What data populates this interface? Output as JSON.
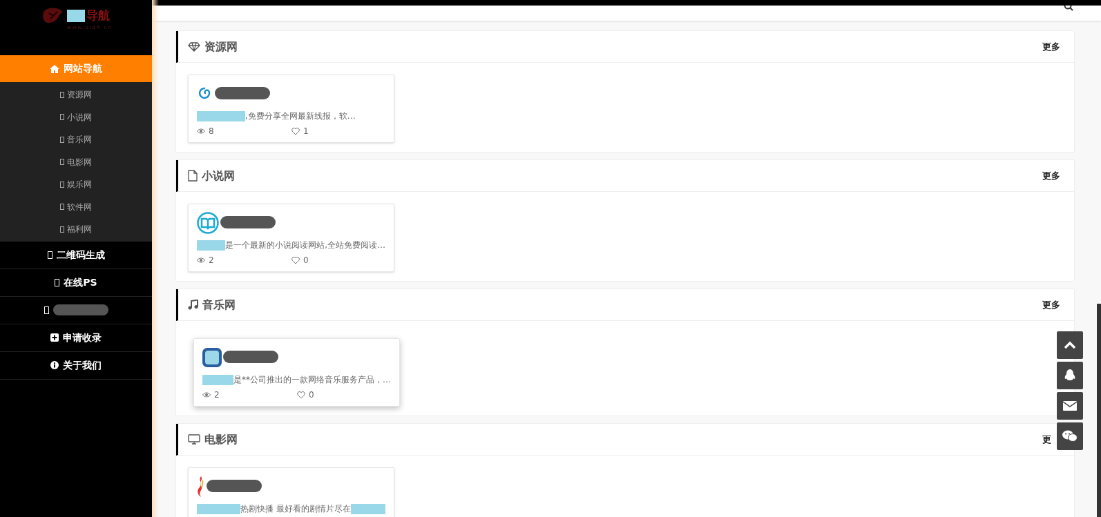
{
  "sidebar": {
    "logo": {
      "text": "导航",
      "subtitle": "www.sidh.cn"
    },
    "nav": [
      {
        "label": "网站导航",
        "kind": "home",
        "selected": true,
        "children": [
          {
            "label": "资源网"
          },
          {
            "label": "小说网"
          },
          {
            "label": "音乐网"
          },
          {
            "label": "电影网"
          },
          {
            "label": "娱乐网"
          },
          {
            "label": "软件网"
          },
          {
            "label": "福利网"
          }
        ]
      },
      {
        "label": "二维码生成",
        "kind": "box",
        "selected": false
      },
      {
        "label": "在线PS",
        "kind": "box",
        "selected": false
      },
      {
        "kind": "hidden",
        "selected": false
      },
      {
        "label": "申请收录",
        "kind": "plus",
        "selected": false
      },
      {
        "label": "关于我们",
        "kind": "info",
        "selected": false
      }
    ]
  },
  "sections": [
    {
      "title": "资源网",
      "kind": "diamond",
      "more": "更多",
      "cards": [
        {
          "description": ",免费分享全网最新线报，软…",
          "views": "8",
          "likes": "1",
          "hovered": false
        }
      ]
    },
    {
      "title": "小说网",
      "kind": "file",
      "more": "更多",
      "cards": [
        {
          "description": "是一个最新的小说阅读网站,全站免费阅读…",
          "views": "2",
          "likes": "0",
          "hovered": false
        }
      ]
    },
    {
      "title": "音乐网",
      "kind": "music",
      "more": "更多",
      "cards": [
        {
          "description": "是**公司推出的一款网络音乐服务产品，…",
          "views": "2",
          "likes": "0",
          "hovered": true
        }
      ]
    },
    {
      "title": "电影网",
      "kind": "monitor",
      "more": "更",
      "cards": [
        {
          "description": "热剧快播 最好看的剧情片尽在",
          "hovered": false
        }
      ]
    }
  ],
  "float_buttons": [
    {
      "kind": "top"
    },
    {
      "kind": "qq"
    },
    {
      "kind": "mail"
    },
    {
      "kind": "wechat"
    }
  ]
}
